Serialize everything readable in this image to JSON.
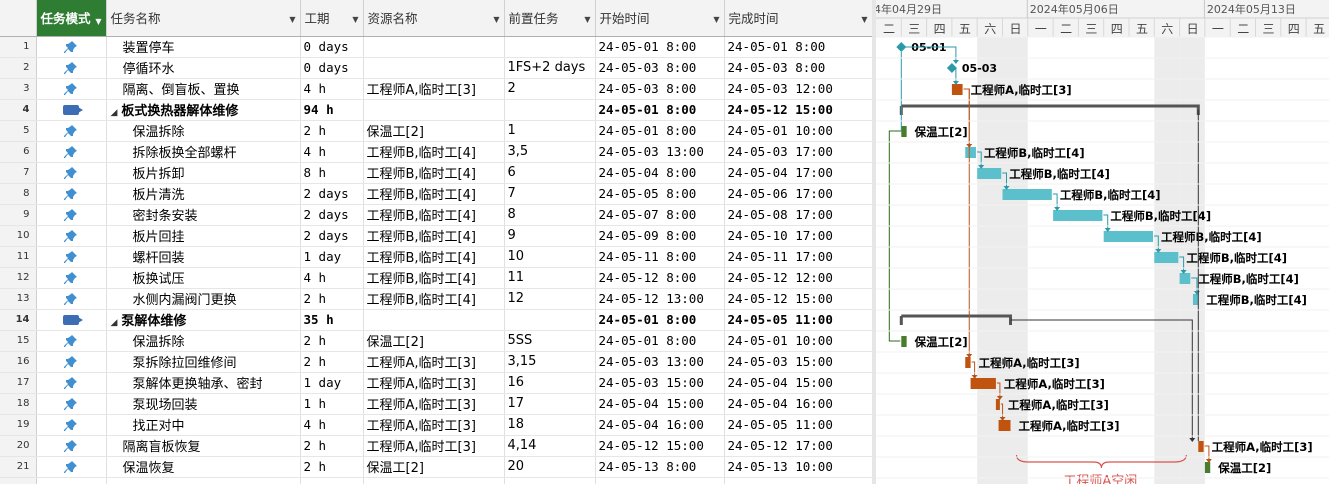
{
  "columns": {
    "num": "",
    "mode": "任务模式",
    "name": "任务名称",
    "duration": "工期",
    "resource": "资源名称",
    "predecessor": "前置任务",
    "start": "开始时间",
    "finish": "完成时间"
  },
  "timescale": {
    "weeks": [
      "4年04月29日",
      "2024年05月06日",
      "2024年05月13日"
    ],
    "days": [
      "二",
      "三",
      "四",
      "五",
      "六",
      "日",
      "一",
      "二",
      "三",
      "四",
      "五",
      "六",
      "日",
      "一",
      "二",
      "三",
      "四",
      "五"
    ]
  },
  "tasks": [
    {
      "id": "1",
      "name": "装置停车",
      "duration": "0 days",
      "resource": "",
      "pred": "",
      "start": "24-05-01 8:00",
      "finish": "24-05-01 8:00",
      "level": 0,
      "summary": false
    },
    {
      "id": "2",
      "name": "停循环水",
      "duration": "0 days",
      "resource": "",
      "pred": "1FS+2 days",
      "start": "24-05-03 8:00",
      "finish": "24-05-03 8:00",
      "level": 0,
      "summary": false
    },
    {
      "id": "3",
      "name": "隔离、倒盲板、置换",
      "duration": "4 h",
      "resource": "工程师A,临时工[3]",
      "pred": "2",
      "start": "24-05-03 8:00",
      "finish": "24-05-03 12:00",
      "level": 0,
      "summary": false
    },
    {
      "id": "4",
      "name": "板式换热器解体维修",
      "duration": "94 h",
      "resource": "",
      "pred": "",
      "start": "24-05-01 8:00",
      "finish": "24-05-12 15:00",
      "level": 0,
      "summary": true
    },
    {
      "id": "5",
      "name": "保温拆除",
      "duration": "2 h",
      "resource": "保温工[2]",
      "pred": "1",
      "start": "24-05-01 8:00",
      "finish": "24-05-01 10:00",
      "level": 1,
      "summary": false
    },
    {
      "id": "6",
      "name": "拆除板换全部螺杆",
      "duration": "4 h",
      "resource": "工程师B,临时工[4]",
      "pred": "3,5",
      "start": "24-05-03 13:00",
      "finish": "24-05-03 17:00",
      "level": 1,
      "summary": false
    },
    {
      "id": "7",
      "name": "板片拆卸",
      "duration": "8 h",
      "resource": "工程师B,临时工[4]",
      "pred": "6",
      "start": "24-05-04 8:00",
      "finish": "24-05-04 17:00",
      "level": 1,
      "summary": false
    },
    {
      "id": "8",
      "name": "板片清洗",
      "duration": "2 days",
      "resource": "工程师B,临时工[4]",
      "pred": "7",
      "start": "24-05-05 8:00",
      "finish": "24-05-06 17:00",
      "level": 1,
      "summary": false
    },
    {
      "id": "9",
      "name": "密封条安装",
      "duration": "2 days",
      "resource": "工程师B,临时工[4]",
      "pred": "8",
      "start": "24-05-07 8:00",
      "finish": "24-05-08 17:00",
      "level": 1,
      "summary": false
    },
    {
      "id": "10",
      "name": "板片回挂",
      "duration": "2 days",
      "resource": "工程师B,临时工[4]",
      "pred": "9",
      "start": "24-05-09 8:00",
      "finish": "24-05-10 17:00",
      "level": 1,
      "summary": false
    },
    {
      "id": "11",
      "name": "螺杆回装",
      "duration": "1 day",
      "resource": "工程师B,临时工[4]",
      "pred": "10",
      "start": "24-05-11 8:00",
      "finish": "24-05-11 17:00",
      "level": 1,
      "summary": false
    },
    {
      "id": "12",
      "name": "板换试压",
      "duration": "4 h",
      "resource": "工程师B,临时工[4]",
      "pred": "11",
      "start": "24-05-12 8:00",
      "finish": "24-05-12 12:00",
      "level": 1,
      "summary": false
    },
    {
      "id": "13",
      "name": "水侧内漏阀门更换",
      "duration": "2 h",
      "resource": "工程师B,临时工[4]",
      "pred": "12",
      "start": "24-05-12 13:00",
      "finish": "24-05-12 15:00",
      "level": 1,
      "summary": false
    },
    {
      "id": "14",
      "name": "泵解体维修",
      "duration": "35 h",
      "resource": "",
      "pred": "",
      "start": "24-05-01 8:00",
      "finish": "24-05-05 11:00",
      "level": 0,
      "summary": true
    },
    {
      "id": "15",
      "name": "保温拆除",
      "duration": "2 h",
      "resource": "保温工[2]",
      "pred": "5SS",
      "start": "24-05-01 8:00",
      "finish": "24-05-01 10:00",
      "level": 1,
      "summary": false
    },
    {
      "id": "16",
      "name": "泵拆除拉回维修间",
      "duration": "2 h",
      "resource": "工程师A,临时工[3]",
      "pred": "3,15",
      "start": "24-05-03 13:00",
      "finish": "24-05-03 15:00",
      "level": 1,
      "summary": false
    },
    {
      "id": "17",
      "name": "泵解体更换轴承、密封",
      "duration": "1 day",
      "resource": "工程师A,临时工[3]",
      "pred": "16",
      "start": "24-05-03 15:00",
      "finish": "24-05-04 15:00",
      "level": 1,
      "summary": false
    },
    {
      "id": "18",
      "name": "泵现场回装",
      "duration": "1 h",
      "resource": "工程师A,临时工[3]",
      "pred": "17",
      "start": "24-05-04 15:00",
      "finish": "24-05-04 16:00",
      "level": 1,
      "summary": false
    },
    {
      "id": "19",
      "name": "找正对中",
      "duration": "4 h",
      "resource": "工程师A,临时工[3]",
      "pred": "18",
      "start": "24-05-04 16:00",
      "finish": "24-05-05 11:00",
      "level": 1,
      "summary": false
    },
    {
      "id": "20",
      "name": "隔离盲板恢复",
      "duration": "2 h",
      "resource": "工程师A,临时工[3]",
      "pred": "4,14",
      "start": "24-05-12 15:00",
      "finish": "24-05-12 17:00",
      "level": 0,
      "summary": false
    },
    {
      "id": "21",
      "name": "保温恢复",
      "duration": "2 h",
      "resource": "保温工[2]",
      "pred": "20",
      "start": "24-05-13 8:00",
      "finish": "24-05-13 10:00",
      "level": 0,
      "summary": false
    }
  ],
  "gantt": {
    "milestone_labels": [
      "05-01",
      "05-03"
    ],
    "bar_labels": {
      "3": "工程师A,临时工[3]",
      "5": "保温工[2]",
      "6": "工程师B,临时工[4]",
      "7": "工程师B,临时工[4]",
      "8": "工程师B,临时工[4]",
      "9": "工程师B,临时工[4]",
      "10": "工程师B,临时工[4]",
      "11": "工程师B,临时工[4]",
      "12": "工程师B,临时工[4]",
      "13": "工程师B,临时工[4]",
      "15": "保温工[2]",
      "16": "工程师A,临时工[3]",
      "17": "工程师A,临时工[3]",
      "18": "工程师A,临时工[3]",
      "19": "工程师A,临时工[3]",
      "20": "工程师A,临时工[3]",
      "21": "保温工[2]"
    },
    "annotation": "工程师A空闲",
    "colors": {
      "engineer_a_bar": "#c0530e",
      "engineer_b_bar": "#5bc0cc",
      "insulation_bar": "#4a7c2e",
      "milestone": "#2a9aa8",
      "summary": "#555555",
      "annotation": "#d9534f",
      "weekend_shade": "#ececec",
      "mode_header": "#2e7d32"
    }
  }
}
